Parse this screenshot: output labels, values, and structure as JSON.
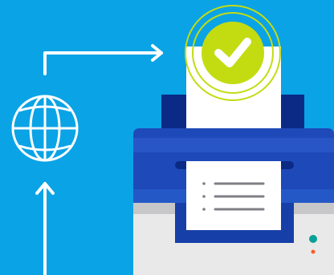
{
  "illustration": {
    "icons": {
      "globe": "globe-icon",
      "arrow_right": "arrow-right-icon",
      "arrow_up": "arrow-up-icon",
      "checkmark": "checkmark-icon",
      "printer": "printer-icon",
      "document_lines": "list-lines-icon"
    },
    "colors": {
      "background": "#0aa3e6",
      "printer_blue_dark": "#0b2a86",
      "printer_blue": "#1e49b9",
      "printer_blue_mid": "#173fa8",
      "printer_body": "#e9e9ea",
      "printer_gray": "#c7c7c9",
      "paper": "#ffffff",
      "check_green": "#c3dc12",
      "line_gray": "#7f7f86",
      "status_teal": "#0aa096",
      "status_orange": "#ff5a1f"
    }
  }
}
